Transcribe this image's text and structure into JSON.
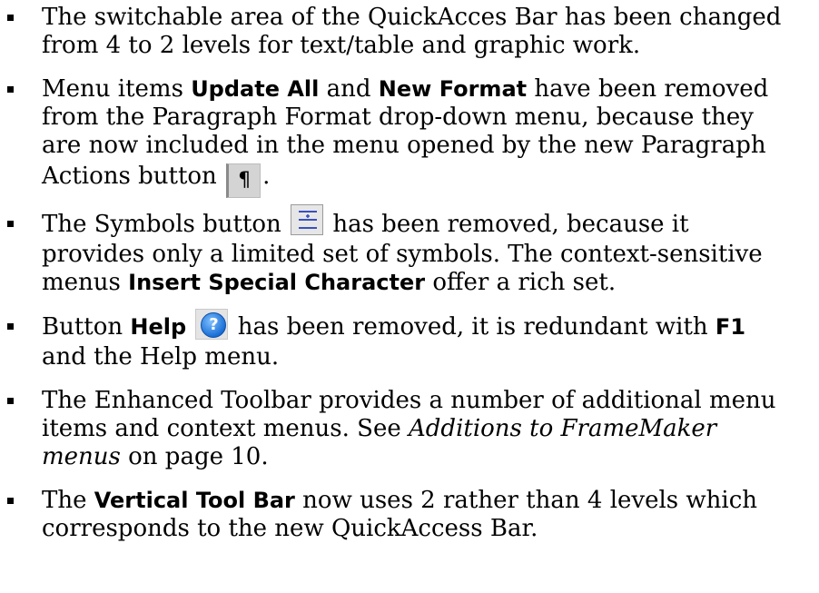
{
  "items": [
    {
      "t1": "The switchable area of the QuickAcces Bar has been changed from 4 to 2 levels for text/table and graphic work."
    },
    {
      "t1": "Menu items ",
      "b1": "Update All",
      "t2": " and ",
      "b2": "New Format",
      "t3": " have been removed from the Paragraph Format drop-down menu, because they are now included in the menu opened by the new Paragraph Actions button ",
      "icon": "pilcrow-icon",
      "icon_glyph": "¶",
      "t4": "."
    },
    {
      "t1": "The Symbols button ",
      "icon": "symbols-icon",
      "t2": " has been removed, because it provides only a limited set of symbols. The context-sensitive menus ",
      "b1": "Insert Special Character",
      "t3": " offer a rich set."
    },
    {
      "t1": "Button ",
      "b1": "Help",
      "icon": "help-icon",
      "icon_glyph": "?",
      "t2": " has been removed, it is redundant with ",
      "b2": "F1",
      "t3": " and the Help menu."
    },
    {
      "t1": "The Enhanced Toolbar provides a number of additional menu items and context menus. See ",
      "i1": "Additions to FrameMaker menus",
      "t2": " on page 10."
    },
    {
      "t1": "The ",
      "b1": "Vertical Tool Bar",
      "t2": " now uses 2 rather than 4 levels which corresponds to the new QuickAccess Bar."
    }
  ],
  "colors": {
    "text": "#000000",
    "help_blue": "#1a6fd6",
    "symbols_blue": "#3a4fc0"
  }
}
